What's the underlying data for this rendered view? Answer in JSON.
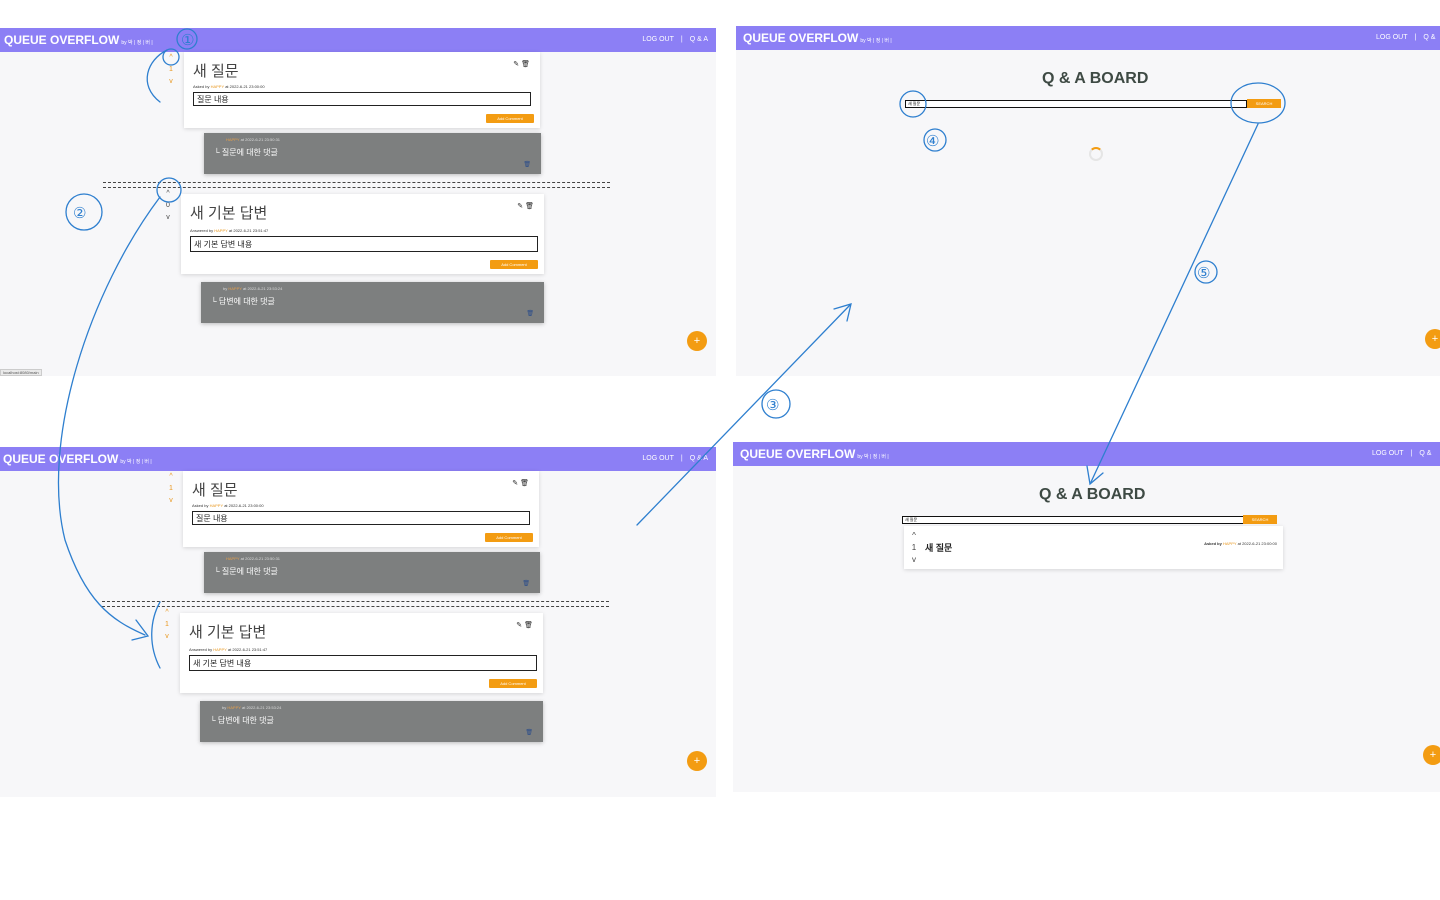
{
  "app": {
    "brand": "QUEUE OVERFLOW",
    "brand_by": "by 박 | 정 | 버 |",
    "nav_logout": "LOG OUT",
    "nav_qa": "Q & A",
    "nav_qa_cut": "Q &",
    "nav_sep": "|",
    "edit_icon": "✎",
    "delete_icon": "🗑",
    "fab_label": "+",
    "url_status": "localhost:8080/main"
  },
  "question": {
    "title": "새 질문",
    "asked_by": "Asked by",
    "user": "HAPPY",
    "at": "at",
    "time": "2022-6-21 23:00:00",
    "body": "질문 내용",
    "add_comment": "Add Comment",
    "vote_up": "^",
    "vote_down": "v",
    "score": "1",
    "comment": {
      "user": "HAPPY",
      "at": "at",
      "time": "2022-6-21 23:50:31",
      "text": "└ 질문에 대한 댓글"
    }
  },
  "divider": "===========================================================================================================================",
  "answer": {
    "title": "새 기본 답변",
    "answered_by": "Answered by",
    "user": "HAPPY",
    "at": "at",
    "time": "2022-6-21 23:51:47",
    "body": "새 기본 답변 내용",
    "add_comment": "Add Comment",
    "vote_up": "^",
    "vote_down": "v",
    "score_before": "0",
    "score_after": "1",
    "comment": {
      "by": "by",
      "user": "HAPPY",
      "at": "at",
      "time": "2022-6-21 23:53:24",
      "text": "└ 답변에 대한 댓글"
    }
  },
  "board": {
    "title": "Q & A BOARD",
    "search_value": "새 질문",
    "search_label": "SEARCH",
    "result": {
      "vote_up": "^",
      "score": "1",
      "vote_down": "v",
      "title": "새 질문",
      "asked_by": "Asked by",
      "user": "HAPPY",
      "at": "at",
      "time": "2022-6-21 23:00:00"
    }
  },
  "annotations": {
    "step1": "①",
    "step2": "②",
    "step3": "③",
    "step4": "④",
    "step5": "⑤"
  },
  "colors": {
    "header": "#8c7ff5",
    "accent": "#f39c12",
    "annotation": "#2e7fcf",
    "comment_bg": "#7d7f7f"
  }
}
